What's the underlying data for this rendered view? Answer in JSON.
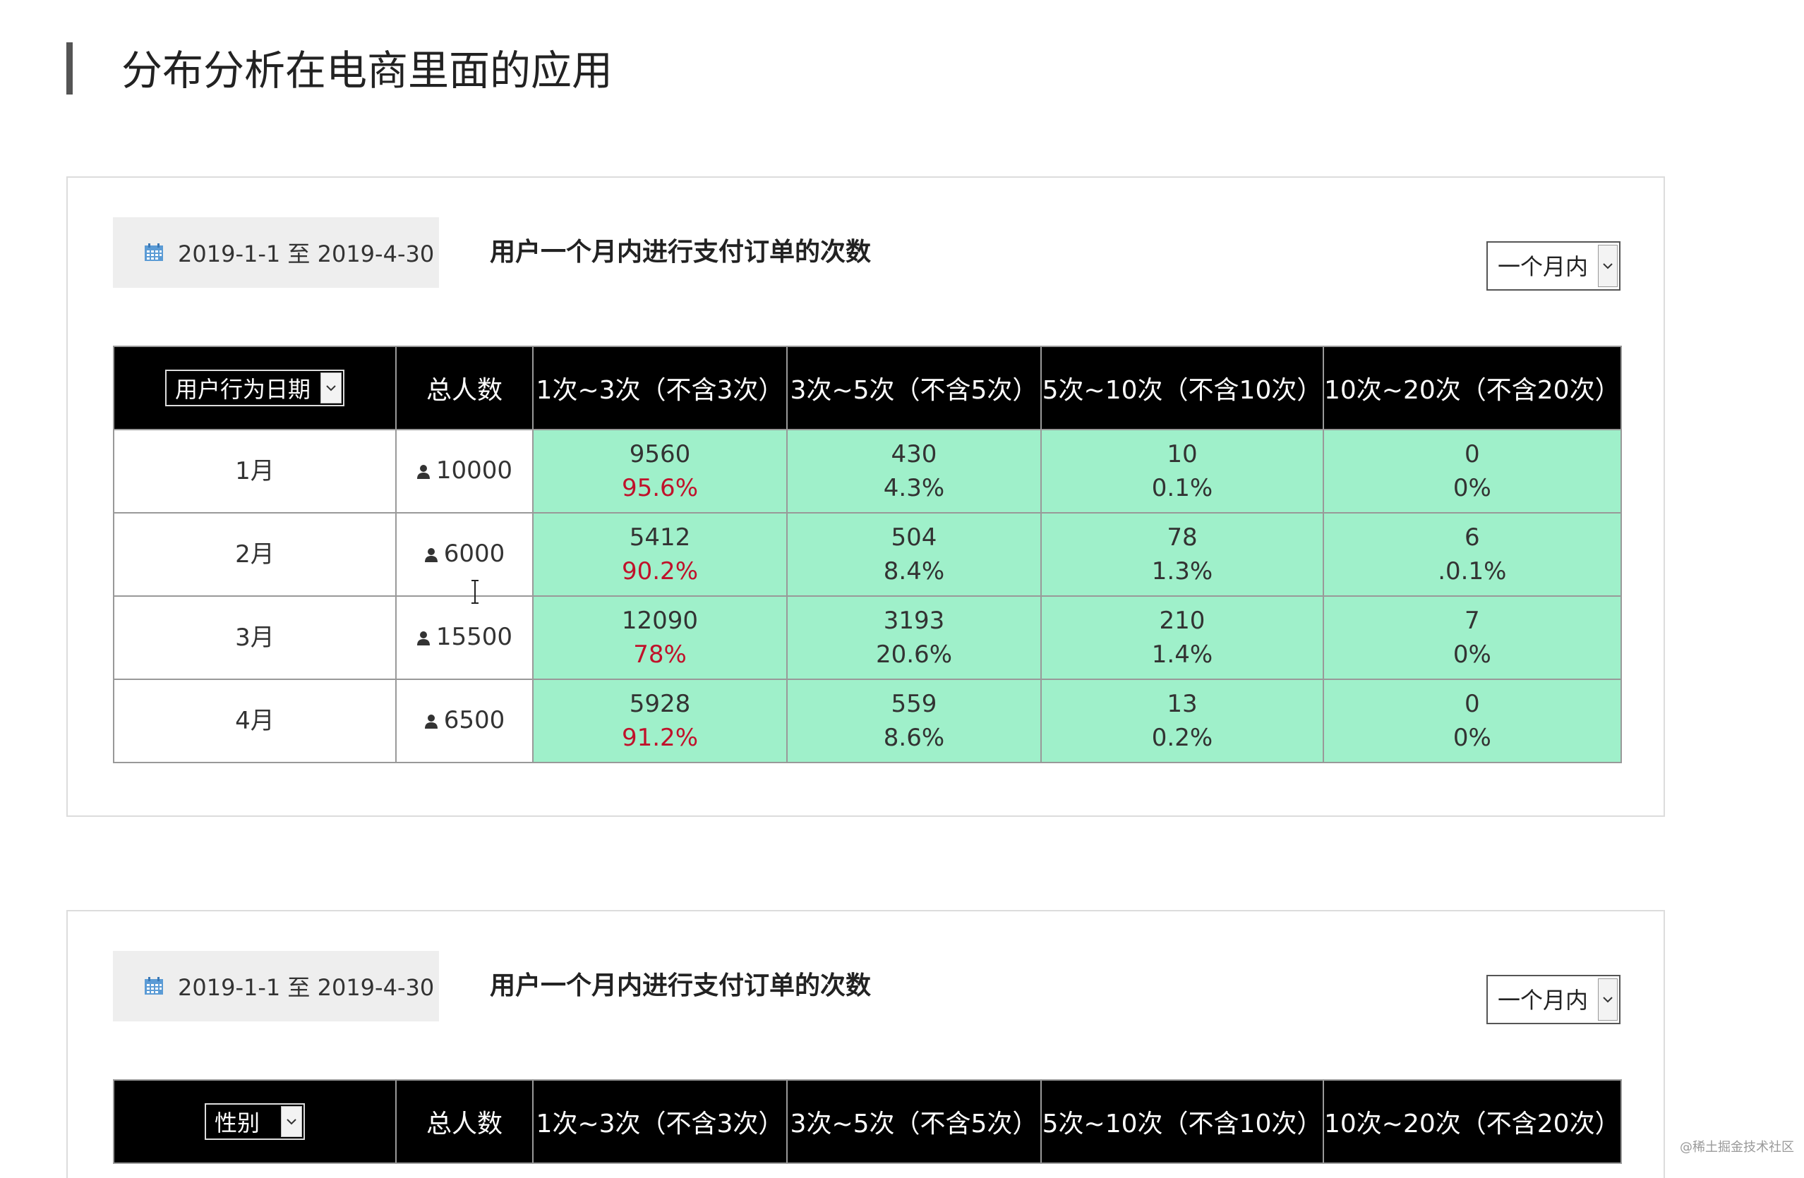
{
  "page": {
    "title": "分布分析在电商里面的应用",
    "watermark": "@稀土掘金技术社区"
  },
  "colors": {
    "header_bg": "#000000",
    "cell_green": "#9ff0ca",
    "pct_red": "#c0122b",
    "date_box_bg": "#eeeeee",
    "calendar_icon": "#5b9bd5"
  },
  "panels": [
    {
      "date_range": "2019-1-1 至 2019-4-30",
      "title": "用户一个月内进行支付订单的次数",
      "period_select": "一个月内",
      "dimension_select": "用户行为日期",
      "headers": [
        "总人数",
        "1次~3次（不含3次）",
        "3次~5次（不含5次）",
        "5次~10次（不含10次）",
        "10次~20次（不含20次）"
      ],
      "rows": [
        {
          "label": "1月",
          "total": "10000",
          "cells": [
            {
              "count": "9560",
              "pct": "95.6%"
            },
            {
              "count": "430",
              "pct": "4.3%"
            },
            {
              "count": "10",
              "pct": "0.1%"
            },
            {
              "count": "0",
              "pct": "0%"
            }
          ]
        },
        {
          "label": "2月",
          "total": "6000",
          "cells": [
            {
              "count": "5412",
              "pct": "90.2%"
            },
            {
              "count": "504",
              "pct": "8.4%"
            },
            {
              "count": "78",
              "pct": "1.3%"
            },
            {
              "count": "6",
              "pct": ".0.1%"
            }
          ]
        },
        {
          "label": "3月",
          "total": "15500",
          "cells": [
            {
              "count": "12090",
              "pct": "78%"
            },
            {
              "count": "3193",
              "pct": "20.6%"
            },
            {
              "count": "210",
              "pct": "1.4%"
            },
            {
              "count": "7",
              "pct": "0%"
            }
          ]
        },
        {
          "label": "4月",
          "total": "6500",
          "cells": [
            {
              "count": "5928",
              "pct": "91.2%"
            },
            {
              "count": "559",
              "pct": "8.6%"
            },
            {
              "count": "13",
              "pct": "0.2%"
            },
            {
              "count": "0",
              "pct": "0%"
            }
          ]
        }
      ]
    },
    {
      "date_range": "2019-1-1 至 2019-4-30",
      "title": "用户一个月内进行支付订单的次数",
      "period_select": "一个月内",
      "dimension_select": "性别",
      "headers": [
        "总人数",
        "1次~3次（不含3次）",
        "3次~5次（不含5次）",
        "5次~10次（不含10次）",
        "10次~20次（不含20次）"
      ]
    }
  ]
}
